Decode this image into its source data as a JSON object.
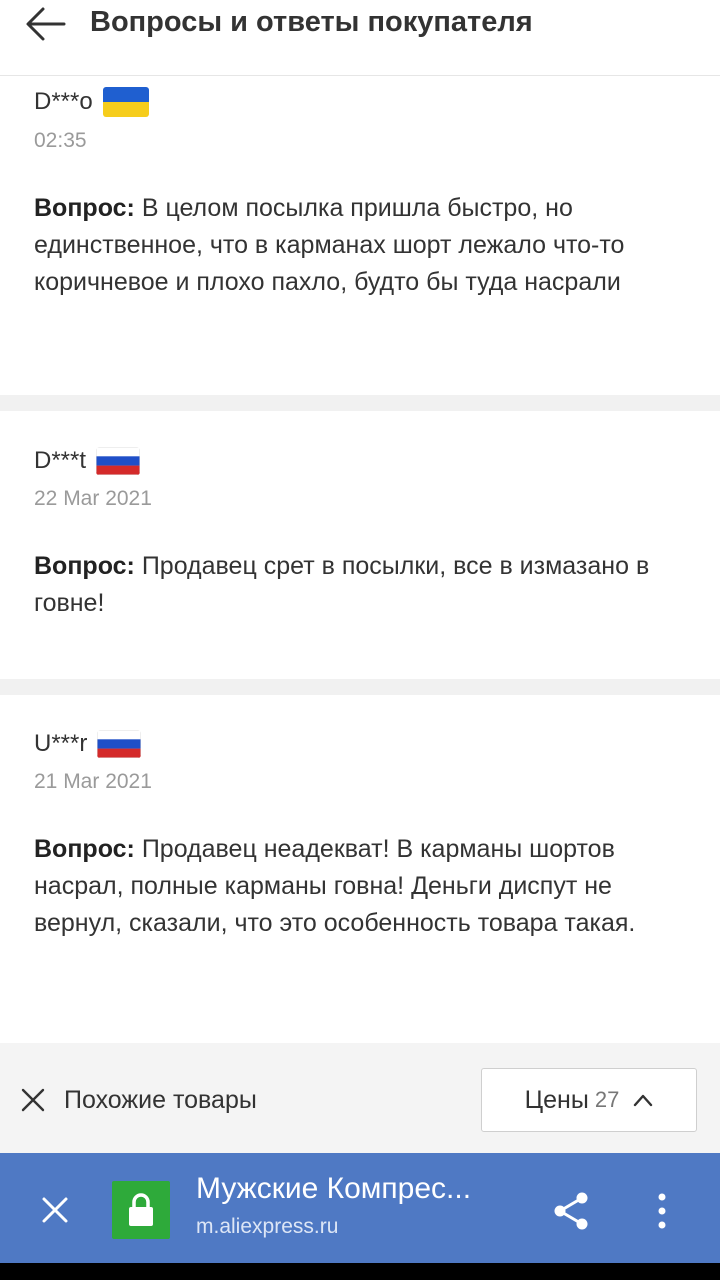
{
  "header": {
    "title": "Вопросы и ответы покупателя",
    "back_icon": "arrow-left-icon"
  },
  "questions": [
    {
      "user": "D***o",
      "flag": "ukraine",
      "date": "02:35",
      "label": "Вопрос:",
      "text": "В целом посылка пришла быстро, но единственное, что в карманах шорт лежало что-то коричневое и плохо пахло, будто бы туда насрали"
    },
    {
      "user": "D***t",
      "flag": "russia",
      "date": "22 Mar 2021",
      "label": "Вопрос:",
      "text": "Продавец срет в посылки, все в измазано в говне!"
    },
    {
      "user": "U***r",
      "flag": "russia",
      "date": "21 Mar 2021",
      "label": "Вопрос:",
      "text": "Продавец неадекват! В карманы шортов насрал, полные карманы говна! Деньги диспут не вернул, сказали, что это особенность товара такая."
    }
  ],
  "bottom_bar": {
    "similar_label": "Похожие товары",
    "price_label": "Цены",
    "price_count": "27"
  },
  "browser_bar": {
    "title": "Мужские Компрес...",
    "url": "m.aliexpress.ru"
  },
  "colors": {
    "browser_bar": "#4f79c4",
    "lock_green": "#2eaa3a",
    "ukraine_blue": "#1f5fd0",
    "ukraine_yellow": "#f6cd1c",
    "russia_red": "#d42a2a"
  }
}
